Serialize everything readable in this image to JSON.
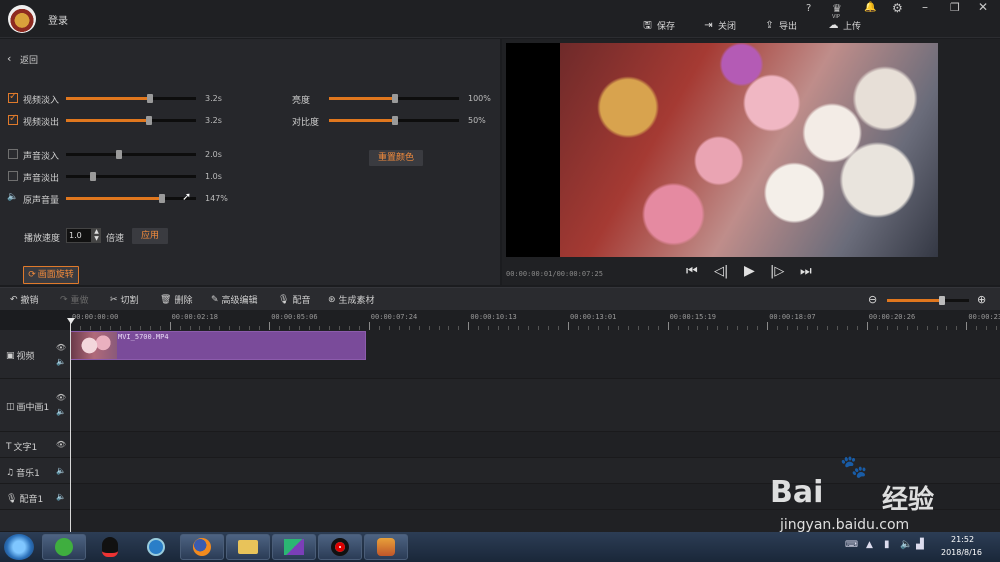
{
  "app": {
    "title": "登录"
  },
  "topbar": {
    "help": "?",
    "vip": "VIP",
    "save": "保存",
    "close": "关闭",
    "export": "导出",
    "upload": "上传"
  },
  "left": {
    "back": "返回",
    "fade_in_video": {
      "label": "视频淡入",
      "value": "3.2s",
      "checked": true,
      "level": 0.64
    },
    "fade_out_video": {
      "label": "视频淡出",
      "value": "3.2s",
      "checked": true,
      "level": 0.64
    },
    "brightness": {
      "label": "亮度",
      "value": "100%",
      "level": 0.5
    },
    "contrast": {
      "label": "对比度",
      "value": "50%",
      "level": 0.5
    },
    "reset_color": "重置颜色",
    "fade_in_audio": {
      "label": "声音淡入",
      "value": "2.0s",
      "checked": false,
      "level": 0.4
    },
    "fade_out_audio": {
      "label": "声音淡出",
      "value": "1.0s",
      "checked": false,
      "level": 0.2
    },
    "original_volume": {
      "label": "原声音量",
      "value": "147%",
      "level": 0.74
    },
    "speed_label": "播放速度",
    "speed_value": "1.0",
    "speed_unit": "倍速",
    "apply": "应用",
    "rotate": "画面旋转"
  },
  "preview": {
    "time": "00:00:00:01/00:00:07:25"
  },
  "toolbar": {
    "undo": "撤销",
    "redo": "重做",
    "cut": "切割",
    "delete": "删除",
    "advanced": "高级编辑",
    "dub": "配音",
    "generate": "生成素材",
    "zoom_level": 0.8
  },
  "ruler": {
    "labels": [
      "00:00:00:00",
      "00:00:02:18",
      "00:00:05:06",
      "00:00:07:24",
      "00:00:10:13",
      "00:00:13:01",
      "00:00:15:19",
      "00:00:18:07",
      "00:00:20:26",
      "00:00:23:"
    ]
  },
  "tracks": {
    "video": "视频",
    "pip": "画中画1",
    "text": "文字1",
    "music": "音乐1",
    "voice": "配音1",
    "clip_name": "MVI_5700.MP4"
  },
  "taskbar": {
    "time": "21:52",
    "date": "2018/8/16"
  },
  "watermark": {
    "brand": "Bai",
    "brand2": "经验",
    "url": "jingyan.baidu.com"
  }
}
